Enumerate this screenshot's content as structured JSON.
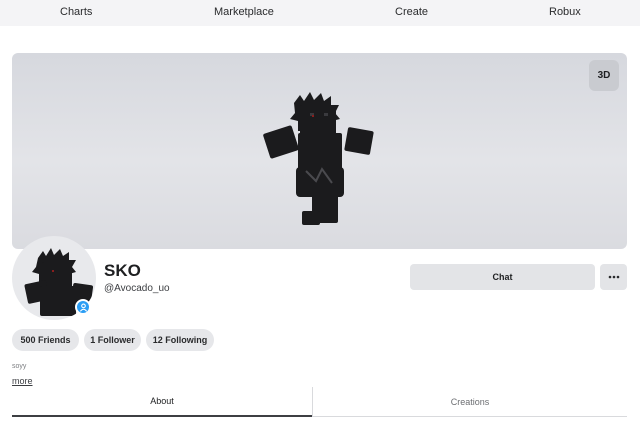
{
  "nav": {
    "items": [
      "Charts",
      "Marketplace",
      "Create",
      "Robux"
    ]
  },
  "banner": {
    "view_3d_label": "3D"
  },
  "profile": {
    "display_name": "SKO",
    "username": "@Avocado_uo",
    "chat_label": "Chat",
    "stats": [
      "500 Friends",
      "1 Follower",
      "12 Following"
    ],
    "bio": "soyy",
    "more_label": "more"
  },
  "tabs": {
    "about": "About",
    "creations": "Creations"
  },
  "colors": {
    "presence": "#2a9df4",
    "button_bg": "#e3e4e7"
  },
  "icons": {
    "more_options": "more-horizontal-icon",
    "presence": "user-presence-icon"
  }
}
